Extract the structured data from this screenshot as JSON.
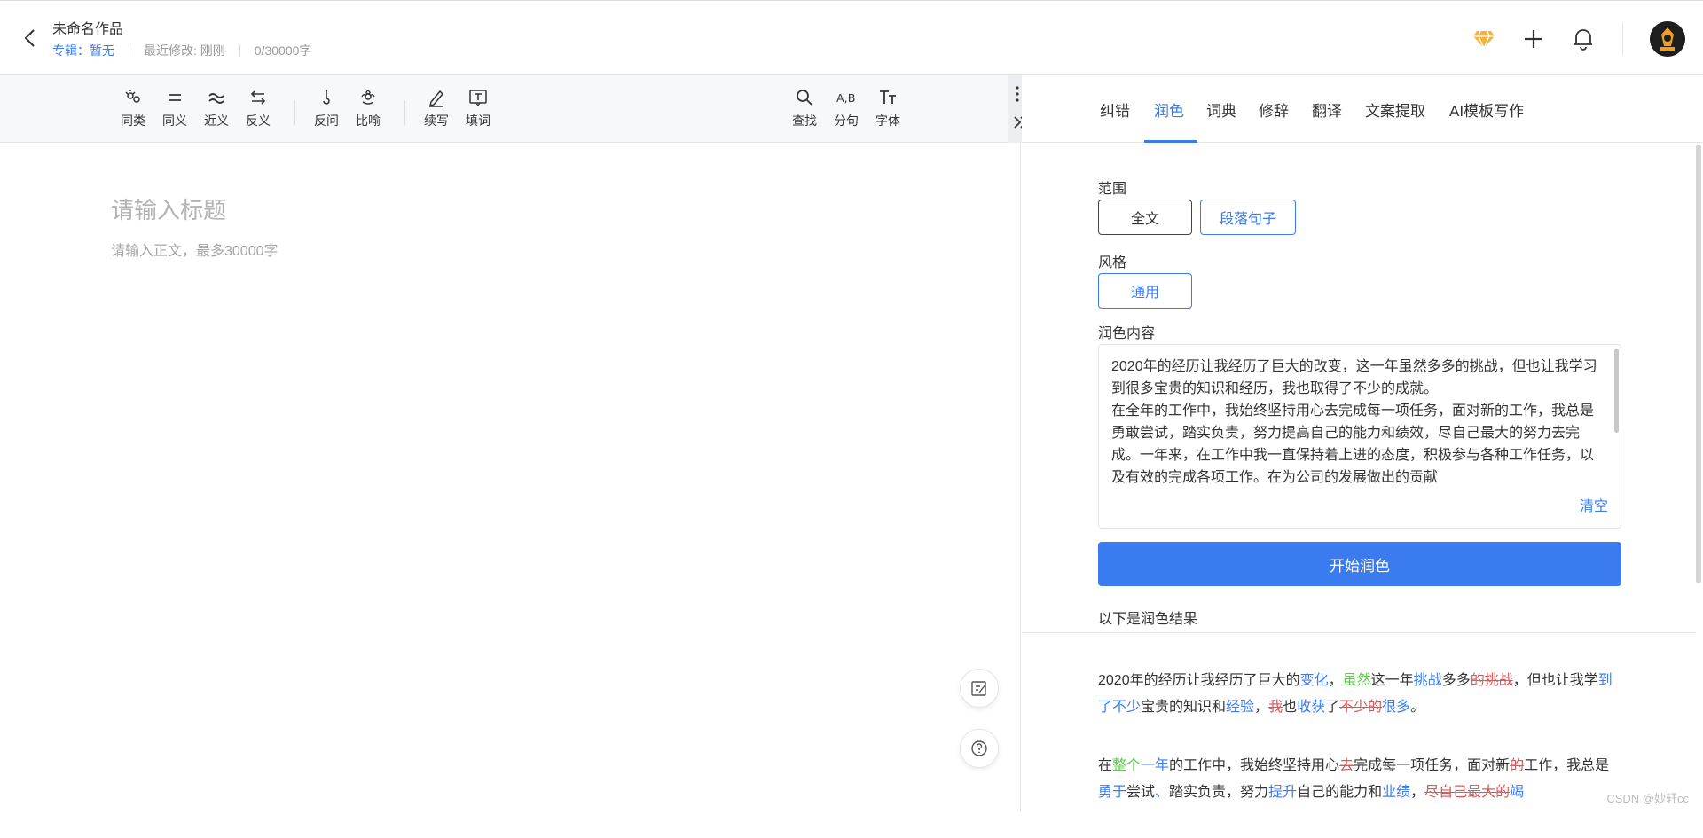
{
  "header": {
    "doc_title": "未命名作品",
    "album": "专辑：暂无",
    "last_modified": "最近修改: 刚刚",
    "word_count": "0/30000字"
  },
  "toolbar": {
    "groups": [
      [
        {
          "label": "同类",
          "icon": "cluster-icon"
        },
        {
          "label": "同义",
          "icon": "equals-icon"
        },
        {
          "label": "近义",
          "icon": "approx-icon"
        },
        {
          "label": "反义",
          "icon": "swap-arrows-icon"
        }
      ],
      [
        {
          "label": "反问",
          "icon": "question-hook-icon"
        },
        {
          "label": "比喻",
          "icon": "flower-icon"
        }
      ],
      [
        {
          "label": "续写",
          "icon": "pen-icon"
        },
        {
          "label": "填词",
          "icon": "text-box-icon"
        }
      ],
      [
        {
          "label": "查找",
          "icon": "search-icon"
        },
        {
          "label": "分句",
          "icon": "split-text-icon"
        },
        {
          "label": "字体",
          "icon": "font-size-icon"
        }
      ]
    ]
  },
  "editor": {
    "title_placeholder": "请输入标题",
    "body_placeholder": "请输入正文，最多30000字"
  },
  "panel": {
    "tabs": [
      "纠错",
      "润色",
      "词典",
      "修辞",
      "翻译",
      "文案提取",
      "AI模板写作"
    ],
    "active_tab": "润色",
    "scope_label": "范围",
    "scope_options": [
      "全文",
      "段落句子"
    ],
    "scope_selected": "段落句子",
    "style_label": "风格",
    "style_options": [
      "通用"
    ],
    "content_label": "润色内容",
    "content_text": "2020年的经历让我经历了巨大的改变，这一年虽然多多的挑战，但也让我学习到很多宝贵的知识和经历，我也取得了不少的成就。\n在全年的工作中，我始终坚持用心去完成每一项任务，面对新的工作，我总是勇敢尝试，踏实负责，努力提高自己的能力和绩效，尽自己最大的努力去完成。一年来，在工作中我一直保持着上进的态度，积极参与各种工作任务，以及有效的完成各项工作。在为公司的发展做出的贡献",
    "clear_label": "清空",
    "start_label": "开始润色",
    "result_label": "以下是润色结果",
    "result_paragraphs": [
      [
        {
          "t": "2020年的经历让我经历了巨大的",
          "c": "n"
        },
        {
          "t": "变化",
          "c": "ins"
        },
        {
          "t": "，",
          "c": "n"
        },
        {
          "t": "虽然",
          "c": "grn"
        },
        {
          "t": "这一年",
          "c": "n"
        },
        {
          "t": "挑战",
          "c": "ins"
        },
        {
          "t": "多多",
          "c": "n"
        },
        {
          "t": "的挑战",
          "c": "del"
        },
        {
          "t": "，但也让我学",
          "c": "n"
        },
        {
          "t": "到了不少",
          "c": "ins"
        },
        {
          "t": "宝贵的知识和",
          "c": "n"
        },
        {
          "t": "经验",
          "c": "ins"
        },
        {
          "t": "，",
          "c": "n"
        },
        {
          "t": "我",
          "c": "del"
        },
        {
          "t": "也",
          "c": "n"
        },
        {
          "t": "收获",
          "c": "ins"
        },
        {
          "t": "了",
          "c": "n"
        },
        {
          "t": "不少的",
          "c": "del"
        },
        {
          "t": "很多",
          "c": "ins"
        },
        {
          "t": "。",
          "c": "n"
        }
      ],
      [
        {
          "t": "在",
          "c": "n"
        },
        {
          "t": "整个",
          "c": "grn"
        },
        {
          "t": "一年",
          "c": "ins"
        },
        {
          "t": "的工作中，我始终坚持用心",
          "c": "n"
        },
        {
          "t": "去",
          "c": "del"
        },
        {
          "t": "完成每一项任务，面对新",
          "c": "n"
        },
        {
          "t": "的",
          "c": "del"
        },
        {
          "t": "工作，我总是",
          "c": "n"
        },
        {
          "t": "勇于",
          "c": "ins"
        },
        {
          "t": "尝试",
          "c": "n"
        },
        {
          "t": "、",
          "c": "ins"
        },
        {
          "t": "踏实负责，努力",
          "c": "n"
        },
        {
          "t": "提升",
          "c": "ins"
        },
        {
          "t": "自己的能力和",
          "c": "n"
        },
        {
          "t": "业绩",
          "c": "ins"
        },
        {
          "t": "，",
          "c": "n"
        },
        {
          "t": "尽自己最大的",
          "c": "del"
        },
        {
          "t": "竭",
          "c": "ins"
        }
      ]
    ],
    "watermark": "CSDN @妙轩cc"
  },
  "colors": {
    "accent": "#3a7bf0",
    "insert": "#3a7bf0",
    "green": "#5cc94a",
    "delete": "#e05555"
  }
}
